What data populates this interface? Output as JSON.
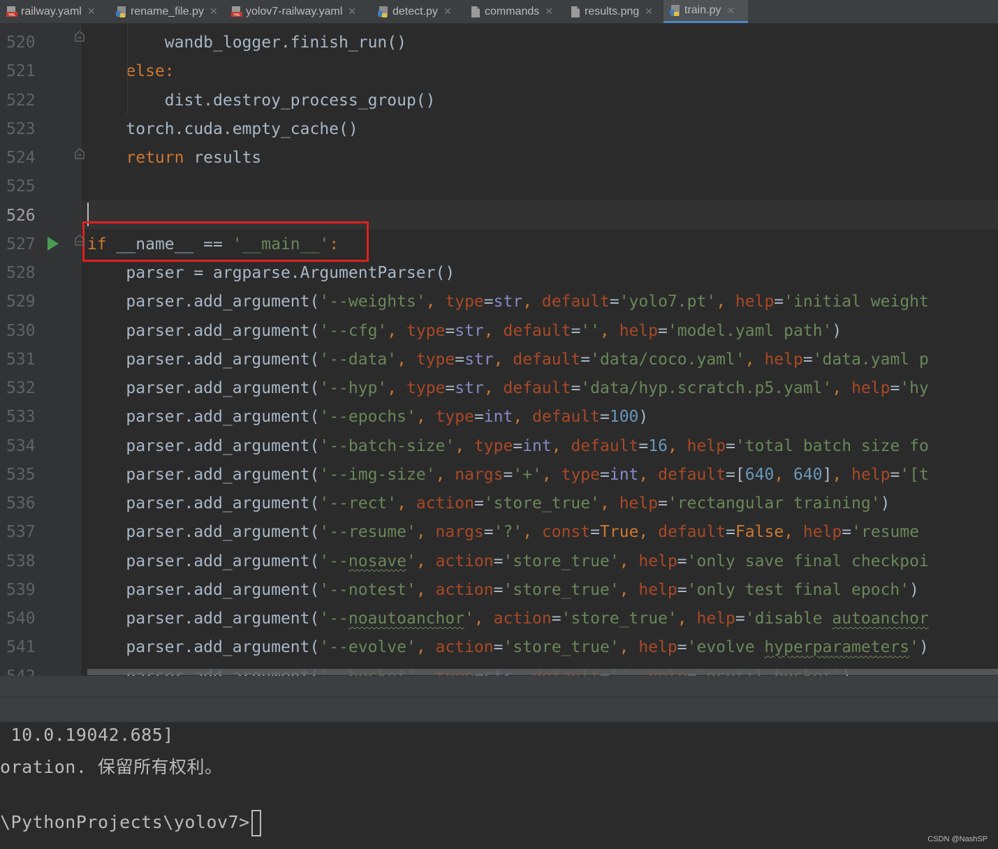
{
  "tabs": [
    {
      "name": "railway.yaml",
      "type": "yaml"
    },
    {
      "name": "rename_file.py",
      "type": "py"
    },
    {
      "name": "yolov7-railway.yaml",
      "type": "yaml"
    },
    {
      "name": "detect.py",
      "type": "py"
    },
    {
      "name": "commands",
      "type": "file"
    },
    {
      "name": "results.png",
      "type": "file"
    },
    {
      "name": "train.py",
      "type": "py",
      "active": true
    }
  ],
  "icons": {
    "yaml": "yaml-file-icon",
    "py": "python-file-icon",
    "file": "text-file-icon",
    "close": "close-icon",
    "run": "run-icon"
  },
  "editor": {
    "current_line": "526",
    "lines": [
      {
        "n": "520",
        "text": "        wandb_logger.finish_run()"
      },
      {
        "n": "521",
        "text": "    else:"
      },
      {
        "n": "522",
        "text": "        dist.destroy_process_group()"
      },
      {
        "n": "523",
        "text": "    torch.cuda.empty_cache()"
      },
      {
        "n": "524",
        "text": "    return results"
      },
      {
        "n": "525",
        "text": ""
      },
      {
        "n": "526",
        "text": ""
      },
      {
        "n": "527",
        "text": "if __name__ == '__main__':"
      },
      {
        "n": "528",
        "text": "    parser = argparse.ArgumentParser()"
      },
      {
        "n": "529",
        "text": "    parser.add_argument('--weights', type=str, default='yolo7.pt', help='initial weight"
      },
      {
        "n": "530",
        "text": "    parser.add_argument('--cfg', type=str, default='', help='model.yaml path')"
      },
      {
        "n": "531",
        "text": "    parser.add_argument('--data', type=str, default='data/coco.yaml', help='data.yaml p"
      },
      {
        "n": "532",
        "text": "    parser.add_argument('--hyp', type=str, default='data/hyp.scratch.p5.yaml', help='hy"
      },
      {
        "n": "533",
        "text": "    parser.add_argument('--epochs', type=int, default=100)"
      },
      {
        "n": "534",
        "text": "    parser.add_argument('--batch-size', type=int, default=16, help='total batch size fo"
      },
      {
        "n": "535",
        "text": "    parser.add_argument('--img-size', nargs='+', type=int, default=[640, 640], help='[t"
      },
      {
        "n": "536",
        "text": "    parser.add_argument('--rect', action='store_true', help='rectangular training')"
      },
      {
        "n": "537",
        "text": "    parser.add_argument('--resume', nargs='?', const=True, default=False, help='resume "
      },
      {
        "n": "538",
        "text": "    parser.add_argument('--nosave', action='store_true', help='only save final checkpoi"
      },
      {
        "n": "539",
        "text": "    parser.add_argument('--notest', action='store_true', help='only test final epoch')"
      },
      {
        "n": "540",
        "text": "    parser.add_argument('--noautoanchor', action='store_true', help='disable autoanchor"
      },
      {
        "n": "541",
        "text": "    parser.add_argument('--evolve', action='store_true', help='evolve hyperparameters')"
      },
      {
        "n": "542",
        "text": "    parser.add_argument('--bucket', type=str, default='', help='gsutil bucket')"
      }
    ]
  },
  "terminal": {
    "lines": [
      " 10.0.19042.685]",
      "oration. 保留所有权利。",
      "",
      "\\PythonProjects\\yolov7>"
    ]
  },
  "watermark": "CSDN @NashSP",
  "colors": {
    "keyword": "#cc7832",
    "string": "#6a8759",
    "number": "#6897bb",
    "param": "#aa4926",
    "builtin": "#8888c6",
    "text": "#a9b7c6",
    "highlight_box": "#e02020",
    "run": "#499c54"
  }
}
